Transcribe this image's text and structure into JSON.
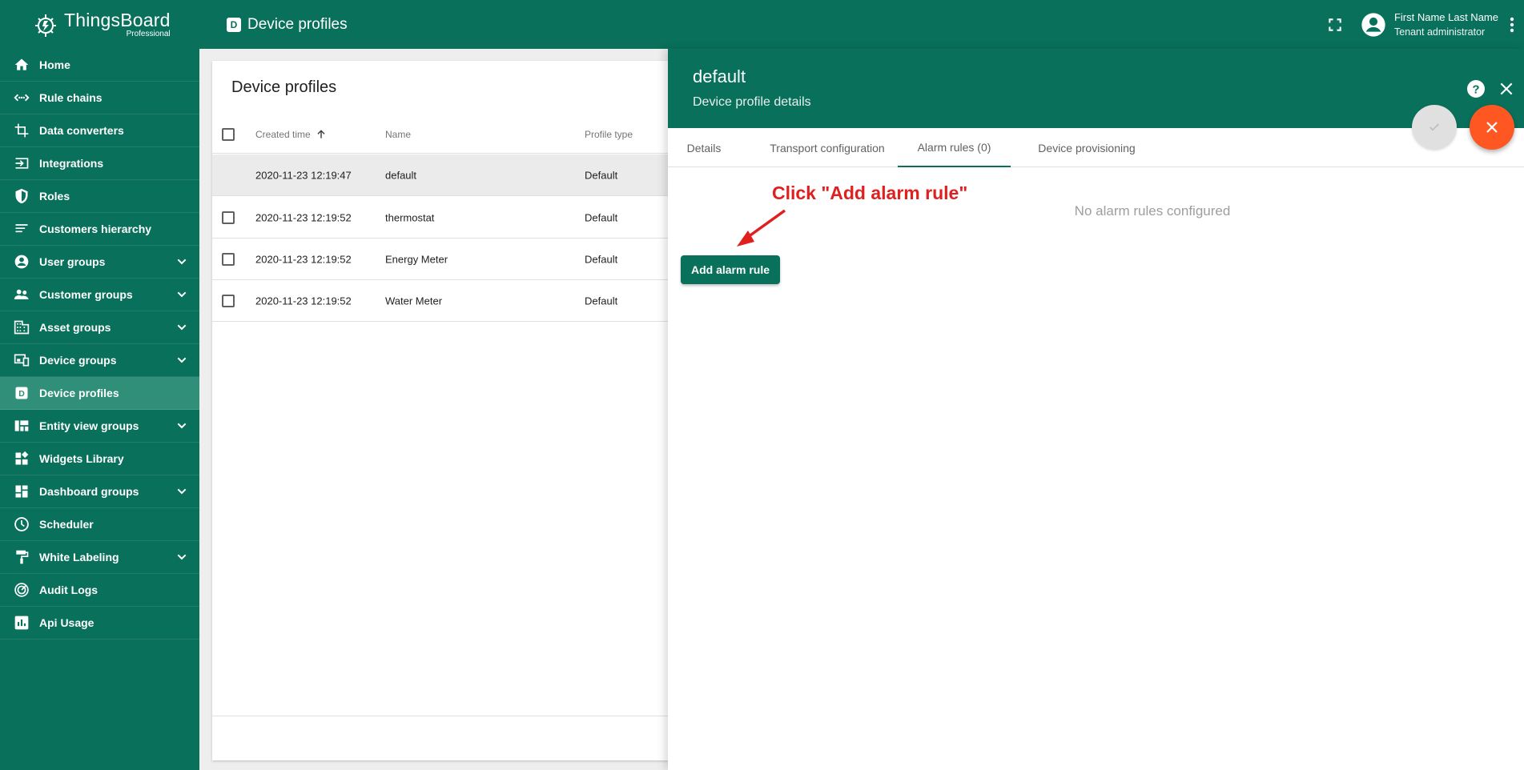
{
  "app": {
    "brand_name": "ThingsBoard",
    "brand_sub": "Professional"
  },
  "sidebar": {
    "items": [
      {
        "label": "Home",
        "icon": "home-icon"
      },
      {
        "label": "Rule chains",
        "icon": "rule-chains-icon"
      },
      {
        "label": "Data converters",
        "icon": "data-converters-icon"
      },
      {
        "label": "Integrations",
        "icon": "integrations-icon"
      },
      {
        "label": "Roles",
        "icon": "shield-icon"
      },
      {
        "label": "Customers hierarchy",
        "icon": "hierarchy-icon"
      },
      {
        "label": "User groups",
        "icon": "account-icon",
        "expandable": true
      },
      {
        "label": "Customer groups",
        "icon": "people-icon",
        "expandable": true
      },
      {
        "label": "Asset groups",
        "icon": "building-icon",
        "expandable": true
      },
      {
        "label": "Device groups",
        "icon": "devices-icon",
        "expandable": true
      },
      {
        "label": "Device profiles",
        "icon": "device-profile-icon",
        "active": true
      },
      {
        "label": "Entity view groups",
        "icon": "view-quilt-icon",
        "expandable": true
      },
      {
        "label": "Widgets Library",
        "icon": "widgets-icon"
      },
      {
        "label": "Dashboard groups",
        "icon": "dashboard-icon",
        "expandable": true
      },
      {
        "label": "Scheduler",
        "icon": "clock-icon"
      },
      {
        "label": "White Labeling",
        "icon": "paint-roller-icon",
        "expandable": true
      },
      {
        "label": "Audit Logs",
        "icon": "track-changes-icon"
      },
      {
        "label": "Api Usage",
        "icon": "insert-chart-icon"
      }
    ]
  },
  "topbar": {
    "badge": "D",
    "title": "Device profiles",
    "user_name": "First Name Last Name",
    "user_role": "Tenant administrator"
  },
  "table": {
    "title": "Device profiles",
    "headers": {
      "created": "Created time",
      "name": "Name",
      "type": "Profile type"
    },
    "rows": [
      {
        "created": "2020-11-23 12:19:47",
        "name": "default",
        "type": "Default",
        "selected": true
      },
      {
        "created": "2020-11-23 12:19:52",
        "name": "thermostat",
        "type": "Default"
      },
      {
        "created": "2020-11-23 12:19:52",
        "name": "Energy Meter",
        "type": "Default"
      },
      {
        "created": "2020-11-23 12:19:52",
        "name": "Water Meter",
        "type": "Default"
      }
    ]
  },
  "panel": {
    "title": "default",
    "subtitle": "Device profile details",
    "tabs": [
      "Details",
      "Transport configuration",
      "Alarm rules (0)",
      "Device provisioning"
    ],
    "active_tab": 2,
    "empty_message": "No alarm rules configured",
    "add_button": "Add alarm rule"
  },
  "annotation": {
    "text": "Click \"Add alarm rule\"",
    "color": "#e01f1f"
  },
  "colors": {
    "primary": "#09705b",
    "sidebar_active": "#2f8f79",
    "fab_accent": "#ff5722"
  }
}
